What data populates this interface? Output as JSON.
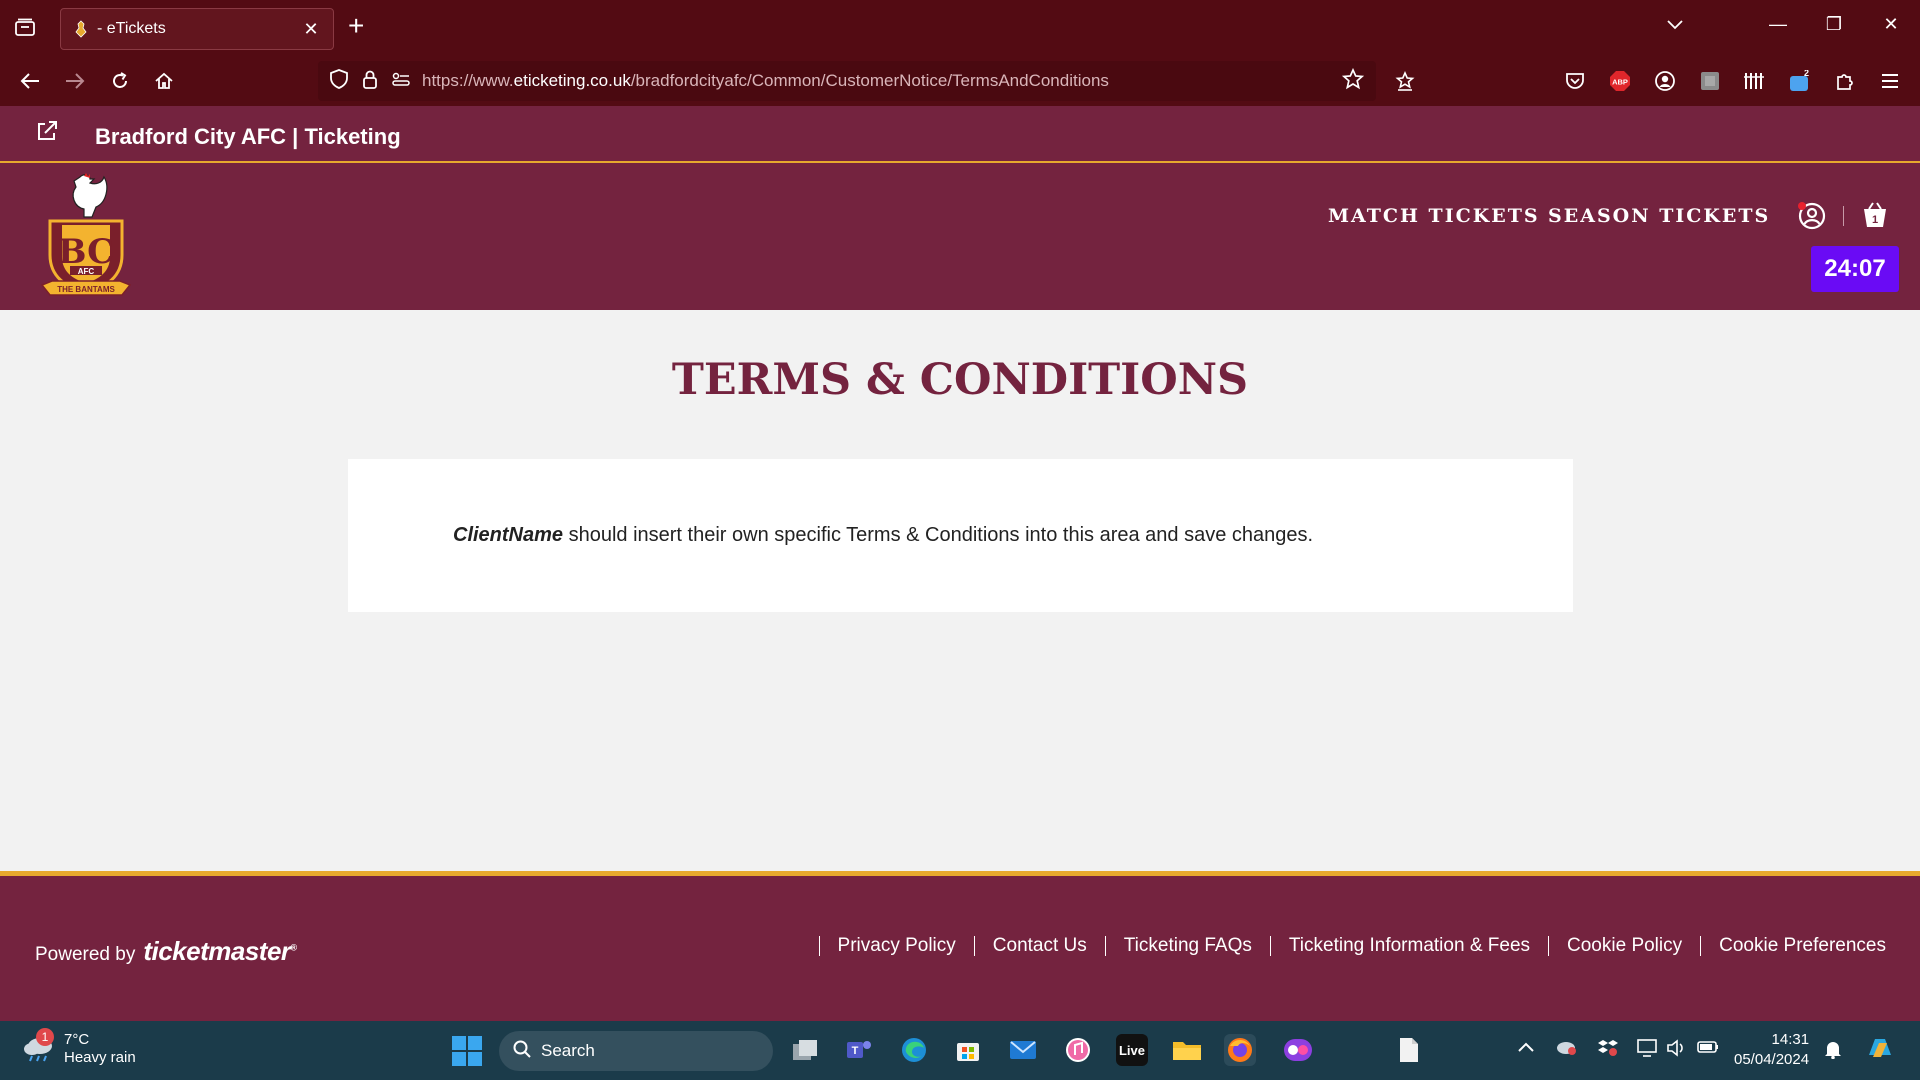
{
  "browser": {
    "tab_title": "- eTickets",
    "tab_close": "✕",
    "new_tab": "+",
    "url_prefix": "https://www.",
    "url_domain": "eticketing.co.uk",
    "url_path": "/bradfordcityafc/Common/CustomerNotice/TermsAndConditions",
    "notification_count": "2",
    "window_controls": {
      "minimize": "—",
      "restore": "❐",
      "close": "✕"
    },
    "icons": [
      "tab-list-icon",
      "back-icon",
      "forward-icon",
      "reload-icon",
      "home-icon",
      "shield-icon",
      "lock-icon",
      "permissions-icon",
      "bookmark-star-icon",
      "reading-list-icon",
      "pocket-icon",
      "adblock-icon",
      "account-icon",
      "extension-square-icon",
      "library-icon",
      "notification-icon",
      "extensions-icon",
      "menu-icon"
    ]
  },
  "site": {
    "header_title": "Bradford City AFC | Ticketing",
    "nav": [
      "MATCH TICKETS",
      "SEASON TICKETS"
    ],
    "timer": "24:07",
    "basket_count": "1",
    "crest_text": {
      "letters": "BC",
      "afc": "AFC",
      "banner": "THE BANTAMS"
    }
  },
  "content": {
    "page_title": "TERMS & CONDITIONS",
    "client_name": "ClientName",
    "notice": " should insert their own specific Terms & Conditions into this area and save changes."
  },
  "footer": {
    "powered_by": "Powered by",
    "brand": "ticketmaster",
    "brand_mark": "®",
    "links": [
      "Privacy Policy",
      "Contact Us",
      "Ticketing FAQs",
      "Ticketing Information & Fees",
      "Cookie Policy",
      "Cookie Preferences"
    ]
  },
  "taskbar": {
    "weather_temp": "7°C",
    "weather_desc": "Heavy rain",
    "weather_badge": "1",
    "search_label": "Search",
    "live_label": "Live",
    "time": "14:31",
    "date": "05/04/2024",
    "apps": [
      "task-view-icon",
      "teams-icon",
      "edge-icon",
      "store-icon",
      "mail-icon",
      "itunes-icon",
      "live-icon",
      "file-explorer-icon",
      "firefox-icon",
      "app-icon",
      "file-icon"
    ]
  },
  "colors": {
    "maroon": "#74233f",
    "browser": "#530b13",
    "gold": "#e7a92e",
    "timer": "#6a0bf5"
  }
}
